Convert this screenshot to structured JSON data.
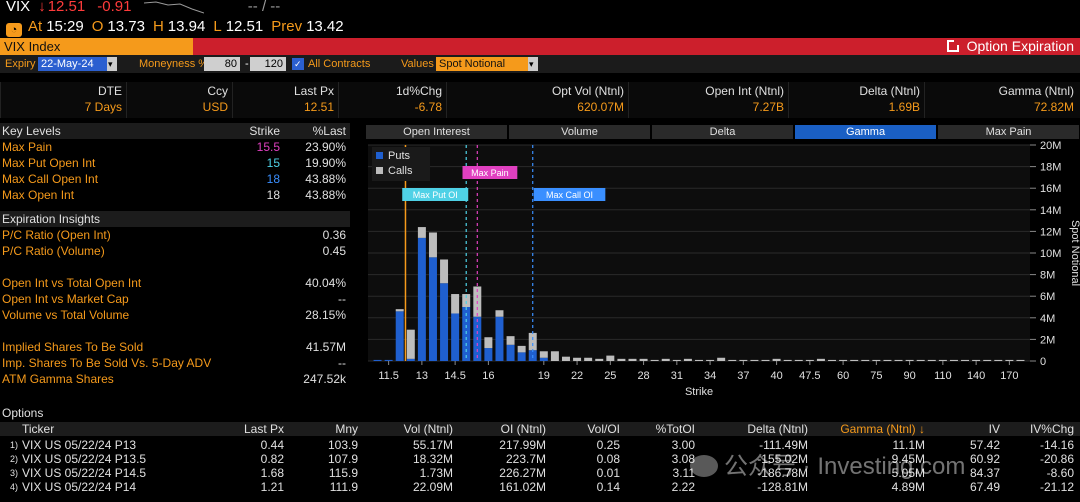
{
  "quote": {
    "ticker": "VIX",
    "arrow": "↓",
    "last": "12.51",
    "change": "-0.91",
    "sparkline_text": "-- / --",
    "time_label": "At",
    "time": "15:29",
    "open_label": "O",
    "open": "13.73",
    "high_label": "H",
    "high": "13.94",
    "low_label": "L",
    "low": "12.51",
    "prev_label": "Prev",
    "prev": "13.42"
  },
  "titlebar": {
    "security": "VIX Index",
    "function_title": "Option Expiration"
  },
  "optbar": {
    "expiry_label": "Expiry",
    "expiry_value": "22-May-24",
    "moneyness_label": "Moneyness %",
    "moneyness_low": "80",
    "moneyness_high": "120",
    "all_contracts_label": "All Contracts",
    "values_label": "Values",
    "values_value": "Spot Notional"
  },
  "summary": {
    "headers": [
      "DTE",
      "Ccy",
      "Last Px",
      "1d%Chg",
      "Opt Vol (Ntnl)",
      "Open Int (Ntnl)",
      "Delta (Ntnl)",
      "Gamma (Ntnl)"
    ],
    "values": [
      "7 Days",
      "USD",
      "12.51",
      "-6.78",
      "620.07M",
      "7.27B",
      "1.69B",
      "72.82M"
    ]
  },
  "key_levels": {
    "header": {
      "label": "Key Levels",
      "strike": "Strike",
      "pct": "%Last"
    },
    "rows": [
      {
        "label": "Max Pain",
        "strike": "15.5",
        "pct": "23.90%",
        "color": "#e040c0"
      },
      {
        "label": "Max Put Open Int",
        "strike": "15",
        "pct": "19.90%",
        "color": "#4fd1e6"
      },
      {
        "label": "Max Call Open Int",
        "strike": "18",
        "pct": "43.88%",
        "color": "#3a8fff"
      },
      {
        "label": "Max Open Int",
        "strike": "18",
        "pct": "43.88%",
        "color": "#e0e0e0"
      }
    ]
  },
  "insights": {
    "header": "Expiration Insights",
    "group1": [
      {
        "label": "P/C Ratio (Open Int)",
        "value": "0.36"
      },
      {
        "label": "P/C Ratio (Volume)",
        "value": "0.45"
      }
    ],
    "group2": [
      {
        "label": "Open Int vs Total Open Int",
        "value": "40.04%"
      },
      {
        "label": "Open Int vs Market Cap",
        "value": "--"
      },
      {
        "label": "Volume vs Total Volume",
        "value": "28.15%"
      }
    ],
    "group3": [
      {
        "label": "Implied Shares To Be Sold",
        "value": "41.57M"
      },
      {
        "label": "Imp. Shares To Be Sold Vs. 5-Day ADV",
        "value": "--"
      },
      {
        "label": "ATM Gamma Shares",
        "value": "247.52k"
      }
    ]
  },
  "chart_tabs": [
    {
      "label": "Open Interest",
      "active": false
    },
    {
      "label": "Volume",
      "active": false
    },
    {
      "label": "Delta",
      "active": false
    },
    {
      "label": "Gamma",
      "active": true
    },
    {
      "label": "Max Pain",
      "active": false
    }
  ],
  "chart_data": {
    "type": "bar",
    "title": "",
    "xlabel": "Strike",
    "ylabel": "Spot Notional",
    "legend": [
      "Puts",
      "Calls"
    ],
    "legend_position": "top-left",
    "ylim": [
      0,
      20
    ],
    "y_unit": "M",
    "y_ticks": [
      "0",
      "2M",
      "4M",
      "6M",
      "8M",
      "10M",
      "12M",
      "14M",
      "16M",
      "18M",
      "20M"
    ],
    "x_tick_labels": [
      "11.5",
      "13",
      "14.5",
      "16",
      "19",
      "22",
      "25",
      "28",
      "31",
      "34",
      "37",
      "40",
      "47.5",
      "60",
      "75",
      "90",
      "110",
      "140",
      "170"
    ],
    "series": [
      {
        "name": "Puts",
        "color": "#1f5fcf",
        "values": [
          0,
          0,
          0,
          0,
          0,
          0,
          0,
          0,
          0,
          0,
          0,
          0,
          0,
          0,
          0,
          0,
          0,
          0,
          0,
          0,
          0,
          0,
          0,
          0,
          0,
          0,
          0,
          0,
          0,
          0,
          0,
          0,
          0,
          0,
          0,
          0,
          0,
          0,
          0,
          0,
          0,
          0,
          0,
          0,
          0,
          0,
          0,
          0,
          0,
          0,
          0,
          0,
          0,
          0,
          0,
          0,
          0,
          0,
          0,
          0,
          0,
          0,
          0,
          0,
          0,
          0,
          0,
          0,
          0,
          0,
          0,
          0,
          0,
          0,
          0,
          0,
          0,
          0,
          0,
          0,
          0
        ]
      },
      {
        "name": "Calls",
        "color": "#bdbdbd",
        "values": []
      }
    ],
    "bars": [
      {
        "strike": "11",
        "puts": 0.1,
        "calls": 0.0
      },
      {
        "strike": "11.5",
        "puts": 0.1,
        "calls": 0.0
      },
      {
        "strike": "12",
        "puts": 4.6,
        "calls": 0.2
      },
      {
        "strike": "12.5",
        "puts": 0.2,
        "calls": 2.7
      },
      {
        "strike": "13",
        "puts": 11.4,
        "calls": 1.0
      },
      {
        "strike": "13.5",
        "puts": 9.6,
        "calls": 2.3
      },
      {
        "strike": "14",
        "puts": 7.2,
        "calls": 2.2
      },
      {
        "strike": "14.5",
        "puts": 4.4,
        "calls": 1.8
      },
      {
        "strike": "15",
        "puts": 5.0,
        "calls": 1.2
      },
      {
        "strike": "15.5",
        "puts": 4.1,
        "calls": 2.8
      },
      {
        "strike": "16",
        "puts": 1.2,
        "calls": 1.0
      },
      {
        "strike": "16.5",
        "puts": 4.1,
        "calls": 0.6
      },
      {
        "strike": "17",
        "puts": 1.5,
        "calls": 0.8
      },
      {
        "strike": "17.5",
        "puts": 0.8,
        "calls": 0.6
      },
      {
        "strike": "18",
        "puts": 1.0,
        "calls": 1.6
      },
      {
        "strike": "19",
        "puts": 0.3,
        "calls": 0.6
      },
      {
        "strike": "20",
        "puts": 0.0,
        "calls": 0.9
      },
      {
        "strike": "21",
        "puts": 0.0,
        "calls": 0.4
      },
      {
        "strike": "22",
        "puts": 0.0,
        "calls": 0.3
      },
      {
        "strike": "23",
        "puts": 0.0,
        "calls": 0.3
      },
      {
        "strike": "24",
        "puts": 0.0,
        "calls": 0.2
      },
      {
        "strike": "25",
        "puts": 0.0,
        "calls": 0.5
      },
      {
        "strike": "26",
        "puts": 0.0,
        "calls": 0.2
      },
      {
        "strike": "27",
        "puts": 0.0,
        "calls": 0.2
      },
      {
        "strike": "28",
        "puts": 0.0,
        "calls": 0.2
      },
      {
        "strike": "29",
        "puts": 0.0,
        "calls": 0.1
      },
      {
        "strike": "30",
        "puts": 0.0,
        "calls": 0.2
      },
      {
        "strike": "31",
        "puts": 0.0,
        "calls": 0.1
      },
      {
        "strike": "32",
        "puts": 0.0,
        "calls": 0.2
      },
      {
        "strike": "33",
        "puts": 0.0,
        "calls": 0.1
      },
      {
        "strike": "34",
        "puts": 0.0,
        "calls": 0.1
      },
      {
        "strike": "35",
        "puts": 0.0,
        "calls": 0.3
      },
      {
        "strike": "36",
        "puts": 0.0,
        "calls": 0.1
      },
      {
        "strike": "37",
        "puts": 0.0,
        "calls": 0.1
      },
      {
        "strike": "38",
        "puts": 0.0,
        "calls": 0.1
      },
      {
        "strike": "39",
        "puts": 0.0,
        "calls": 0.1
      },
      {
        "strike": "40",
        "puts": 0.0,
        "calls": 0.2
      },
      {
        "strike": "42.5",
        "puts": 0.0,
        "calls": 0.1
      },
      {
        "strike": "45",
        "puts": 0.0,
        "calls": 0.1
      },
      {
        "strike": "47.5",
        "puts": 0.0,
        "calls": 0.1
      },
      {
        "strike": "50",
        "puts": 0.0,
        "calls": 0.2
      },
      {
        "strike": "55",
        "puts": 0.0,
        "calls": 0.1
      },
      {
        "strike": "60",
        "puts": 0.0,
        "calls": 0.1
      },
      {
        "strike": "65",
        "puts": 0.0,
        "calls": 0.1
      },
      {
        "strike": "70",
        "puts": 0.0,
        "calls": 0.1
      },
      {
        "strike": "75",
        "puts": 0.0,
        "calls": 0.1
      },
      {
        "strike": "80",
        "puts": 0.0,
        "calls": 0.1
      },
      {
        "strike": "85",
        "puts": 0.0,
        "calls": 0.1
      },
      {
        "strike": "90",
        "puts": 0.0,
        "calls": 0.1
      },
      {
        "strike": "95",
        "puts": 0.0,
        "calls": 0.1
      },
      {
        "strike": "100",
        "puts": 0.0,
        "calls": 0.1
      },
      {
        "strike": "110",
        "puts": 0.0,
        "calls": 0.1
      },
      {
        "strike": "120",
        "puts": 0.0,
        "calls": 0.1
      },
      {
        "strike": "130",
        "puts": 0.0,
        "calls": 0.1
      },
      {
        "strike": "140",
        "puts": 0.0,
        "calls": 0.1
      },
      {
        "strike": "150",
        "puts": 0.0,
        "calls": 0.1
      },
      {
        "strike": "160",
        "puts": 0.0,
        "calls": 0.1
      },
      {
        "strike": "170",
        "puts": 0.0,
        "calls": 0.1
      },
      {
        "strike": "180",
        "puts": 0.0,
        "calls": 0.1
      }
    ],
    "markers": [
      {
        "label": "Max Put OI",
        "strike": "15",
        "color": "#4fd1e6"
      },
      {
        "label": "Max Pain",
        "strike": "15.5",
        "color": "#e040c0"
      },
      {
        "label": "Max Call OI",
        "strike": "18",
        "color": "#3a8fff"
      }
    ],
    "last_price_strike": "12.51",
    "last_price_line_color": "#f59a1b"
  },
  "options": {
    "section_title": "Options",
    "headers": [
      "Ticker",
      "Last Px",
      "Mny",
      "Vol (Ntnl)",
      "OI (Ntnl)",
      "Vol/OI",
      "%TotOI",
      "Delta (Ntnl)",
      "Gamma (Ntnl) ↓",
      "IV",
      "IV%Chg"
    ],
    "rows": [
      {
        "idx": "1)",
        "ticker": "VIX US 05/22/24 P13",
        "last": "0.44",
        "mny": "103.9",
        "vol": "55.17M",
        "oi": "217.99M",
        "voloi": "0.25",
        "totoi": "3.00",
        "delta": "-111.49M",
        "gamma": "11.1M",
        "iv": "57.42",
        "ivchg": "-14.16"
      },
      {
        "idx": "2)",
        "ticker": "VIX US 05/22/24 P13.5",
        "last": "0.82",
        "mny": "107.9",
        "vol": "18.32M",
        "oi": "223.7M",
        "voloi": "0.08",
        "totoi": "3.08",
        "delta": "-155.02M",
        "gamma": "9.45M",
        "iv": "60.92",
        "ivchg": "-20.86"
      },
      {
        "idx": "3)",
        "ticker": "VIX US 05/22/24 P14.5",
        "last": "1.68",
        "mny": "115.9",
        "vol": "1.73M",
        "oi": "226.27M",
        "voloi": "0.01",
        "totoi": "3.11",
        "delta": "-186.78M",
        "gamma": "5.05M",
        "iv": "84.37",
        "ivchg": "-8.60"
      },
      {
        "idx": "4)",
        "ticker": "VIX US 05/22/24 P14",
        "last": "1.21",
        "mny": "111.9",
        "vol": "22.09M",
        "oi": "161.02M",
        "voloi": "0.14",
        "totoi": "2.22",
        "delta": "-128.81M",
        "gamma": "4.89M",
        "iv": "67.49",
        "ivchg": "-21.12"
      }
    ]
  },
  "watermark": "公众号 · Investing.com"
}
